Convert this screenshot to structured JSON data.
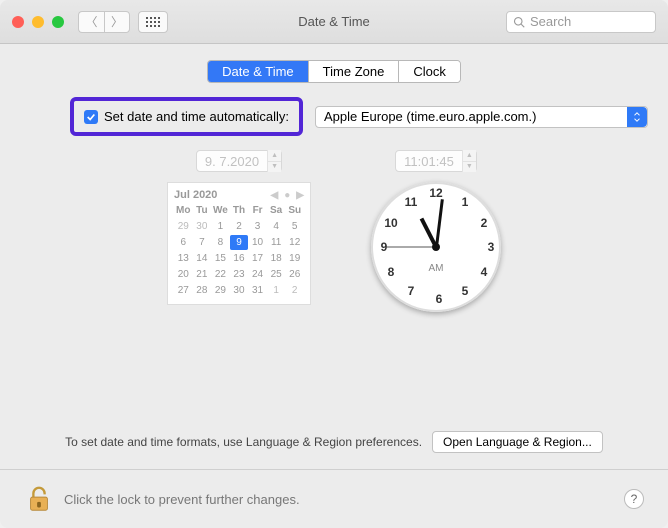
{
  "window": {
    "title": "Date & Time",
    "search_placeholder": "Search"
  },
  "tabs": {
    "date_time": "Date & Time",
    "time_zone": "Time Zone",
    "clock": "Clock"
  },
  "auto": {
    "label": "Set date and time automatically:",
    "server": "Apple Europe (time.euro.apple.com.)",
    "checked": true
  },
  "date_field": "9.  7.2020",
  "time_field": "11:01:45",
  "calendar": {
    "month_label": "Jul 2020",
    "day_headers": [
      "Mo",
      "Tu",
      "We",
      "Th",
      "Fr",
      "Sa",
      "Su"
    ],
    "prev_trail": [
      29,
      30,
      1,
      2,
      3,
      4,
      5
    ],
    "weeks": [
      [
        6,
        7,
        8,
        9,
        10,
        11,
        12
      ],
      [
        13,
        14,
        15,
        16,
        17,
        18,
        19
      ],
      [
        20,
        21,
        22,
        23,
        24,
        25,
        26
      ],
      [
        27,
        28,
        29,
        30,
        31,
        1,
        2
      ]
    ],
    "selected": 9
  },
  "clock": {
    "ampm": "AM",
    "hour": 11,
    "minute": 1,
    "second": 45
  },
  "footer": {
    "hint": "To set date and time formats, use Language & Region preferences.",
    "button": "Open Language & Region..."
  },
  "lock": {
    "text": "Click the lock to prevent further changes."
  }
}
